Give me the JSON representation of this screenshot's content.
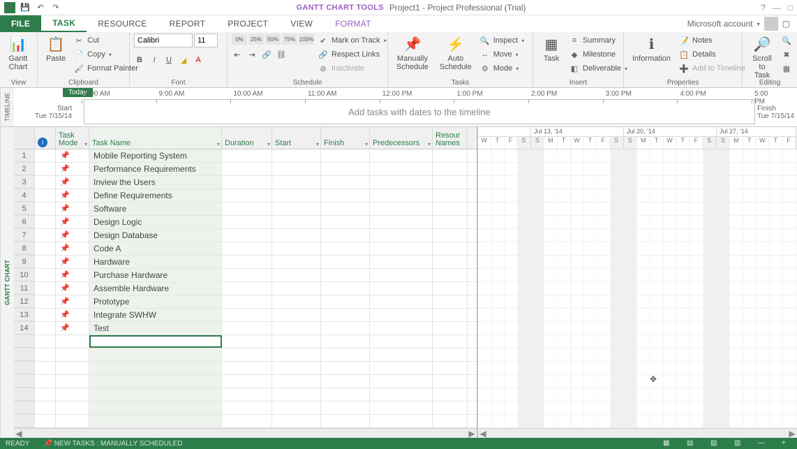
{
  "titlebar": {
    "tool_tab": "GANTT CHART TOOLS",
    "app_title": "Project1 - Project Professional (Trial)",
    "help": "?"
  },
  "tabs": {
    "file": "FILE",
    "task": "TASK",
    "resource": "RESOURCE",
    "report": "REPORT",
    "project": "PROJECT",
    "view": "VIEW",
    "format": "FORMAT",
    "account": "Microsoft account"
  },
  "ribbon": {
    "view_group": {
      "label": "View",
      "gantt": "Gantt\nChart"
    },
    "clipboard": {
      "label": "Clipboard",
      "paste": "Paste",
      "cut": "Cut",
      "copy": "Copy",
      "fmt": "Format Painter"
    },
    "font": {
      "label": "Font",
      "name": "Calibri",
      "size": "11"
    },
    "schedule": {
      "label": "Schedule",
      "p0": "0%",
      "p25": "25%",
      "p50": "50%",
      "p75": "75%",
      "p100": "100%",
      "mark": "Mark on Track",
      "respect": "Respect Links",
      "inactivate": "Inactivate"
    },
    "tasks": {
      "label": "Tasks",
      "manual": "Manually\nSchedule",
      "auto": "Auto\nSchedule",
      "inspect": "Inspect",
      "move": "Move",
      "mode": "Mode"
    },
    "insert": {
      "label": "Insert",
      "task": "Task",
      "summary": "Summary",
      "milestone": "Milestone",
      "deliverable": "Deliverable"
    },
    "properties": {
      "label": "Properties",
      "info": "Information",
      "notes": "Notes",
      "details": "Details",
      "addtl": "Add to Timeline"
    },
    "editing": {
      "label": "Editing",
      "scroll": "Scroll\nto Task"
    }
  },
  "timeline": {
    "side": "TIMELINE",
    "today": "Today",
    "start_lbl": "Start",
    "start_dt": "Tue 7/15/14",
    "finish_lbl": "Finish",
    "finish_dt": "Tue 7/15/14",
    "placeholder": "Add tasks with dates to the timeline",
    "hours": [
      "8:00 AM",
      "9:00 AM",
      "10:00 AM",
      "11:00 AM",
      "12:00 PM",
      "1:00 PM",
      "2:00 PM",
      "3:00 PM",
      "4:00 PM",
      "5:00 PM"
    ]
  },
  "gantt_side": "GANTT CHART",
  "columns": {
    "mode": "Task\nMode",
    "name": "Task Name",
    "duration": "Duration",
    "start": "Start",
    "finish": "Finish",
    "pred": "Predecessors",
    "res": "Resour\nNames"
  },
  "tasks_list": [
    {
      "n": 1,
      "name": "Mobile Reporting System"
    },
    {
      "n": 2,
      "name": "Performance Requirements"
    },
    {
      "n": 3,
      "name": "Inview the Users"
    },
    {
      "n": 4,
      "name": "Define Requirements"
    },
    {
      "n": 5,
      "name": "Software"
    },
    {
      "n": 6,
      "name": "Design Logic"
    },
    {
      "n": 7,
      "name": "Design Database"
    },
    {
      "n": 8,
      "name": "Code A"
    },
    {
      "n": 9,
      "name": "Hardware"
    },
    {
      "n": 10,
      "name": "Purchase Hardware"
    },
    {
      "n": 11,
      "name": "Assemble Hardware"
    },
    {
      "n": 12,
      "name": "Prototype"
    },
    {
      "n": 13,
      "name": "Integrate SWHW"
    },
    {
      "n": 14,
      "name": "Test"
    }
  ],
  "weeks": [
    {
      "label": "Jul 13, '14",
      "days": [
        "S",
        "M",
        "T",
        "W",
        "T",
        "F",
        "S"
      ]
    },
    {
      "label": "Jul 20, '14",
      "days": [
        "S",
        "M",
        "T",
        "W",
        "T",
        "F",
        "S"
      ]
    },
    {
      "label": "Jul 27, '14",
      "days": [
        "S",
        "M",
        "T",
        "W",
        "T",
        "F"
      ]
    }
  ],
  "first_days": [
    "W",
    "T",
    "F",
    "S"
  ],
  "status": {
    "ready": "READY",
    "new": "NEW TASKS : MANUALLY SCHEDULED"
  }
}
